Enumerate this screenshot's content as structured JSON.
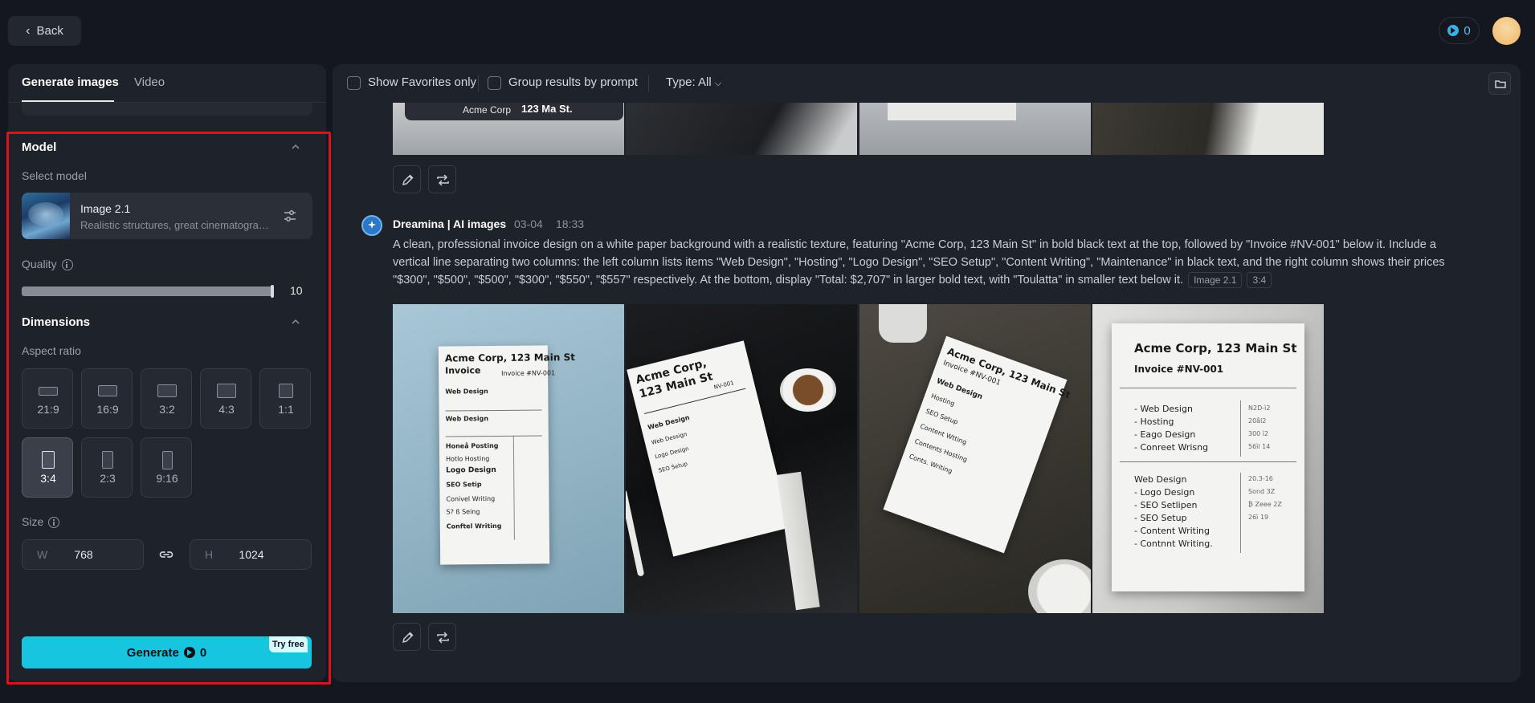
{
  "topbar": {
    "back_label": "Back",
    "credits": "0"
  },
  "left_panel": {
    "tabs": [
      {
        "label": "Generate images",
        "active": true
      },
      {
        "label": "Video",
        "active": false
      }
    ],
    "model_section": {
      "title": "Model",
      "select_label": "Select model",
      "model_name": "Image 2.1",
      "model_desc": "Realistic structures, great cinematography"
    },
    "quality": {
      "label": "Quality",
      "value_text": "10",
      "fraction": 1.0
    },
    "dimensions": {
      "title": "Dimensions",
      "aspect_label": "Aspect ratio",
      "ratios": [
        "21:9",
        "16:9",
        "3:2",
        "4:3",
        "1:1",
        "3:4",
        "2:3",
        "9:16"
      ],
      "selected": "3:4"
    },
    "size": {
      "label": "Size",
      "w_letter": "W",
      "w_value": "768",
      "h_letter": "H",
      "h_value": "1024"
    },
    "generate": {
      "label": "Generate",
      "cost": "0",
      "badge": "Try free"
    }
  },
  "main_panel": {
    "filters": {
      "favorites": "Show Favorites only",
      "group": "Group results by prompt",
      "type": "Type: All"
    },
    "top_row_image_text": [
      "Acme Corp",
      "123 Ma St."
    ],
    "message": {
      "author": "Dreamina | AI images",
      "date": "03-04",
      "time": "18:33",
      "prompt": "A clean, professional invoice design on a white paper background with a realistic texture, featuring \"Acme Corp, 123 Main St\" in bold black text at the top, followed by \"Invoice #NV-001\" below it. Include a vertical line separating two columns: the left column lists items \"Web Design\", \"Hosting\", \"Logo Design\", \"SEO Setup\", \"Content Writing\", \"Maintenance\" in black text, and the right column shows their prices \"$300\", \"$500\", \"$500\", \"$300\", \"$550\", \"$557\" respectively. At the bottom, display \"Total: $2,707\" in larger bold text, with \"Toulatta\" in smaller text below it.",
      "tag_model": "Image 2.1",
      "tag_ratio": "3:4"
    },
    "images": [
      {
        "title": [
          "Acme Corp, 123 Main St",
          "Invoice"
        ],
        "number": "Invoice #NV-001",
        "lines": [
          "Web Design",
          "Web Design",
          "Honeå Posting",
          "Hotlo Hosting",
          "Logo Design",
          "SEO Setip",
          "Conivel Writing",
          "S? ß Seing",
          "Conftel Writing"
        ]
      },
      {
        "title": [
          "Acme Corp,",
          "123 Main St"
        ],
        "number": "NV-001",
        "lines": [
          "Web Design",
          "Web Dessign",
          "Logo Design",
          "SEO Setup"
        ]
      },
      {
        "title": [
          "Acme Corp, 123 Main St",
          "Invoice #NV-001"
        ],
        "number": "",
        "lines": [
          "Web Design",
          "Hosting",
          "SEO Setup",
          "Content Wtting",
          "Contents Hosting",
          "Conts. Writing"
        ]
      },
      {
        "title": [
          "Acme Corp, 123 Main St",
          "Invoice #NV-001"
        ],
        "number": "",
        "lines": [
          "- Web Design",
          "- Hosting",
          "- Eago Design",
          "- Conreet Wrisng",
          "Web Design",
          "- Logo Design",
          "- SEO Setlipen",
          "- SEO Setup",
          "- Content Writing",
          "- Contnnt Writing."
        ],
        "prices": [
          "N2D-ì2",
          "20ål2",
          "300 ì2",
          "56ìl 14",
          "20.3-16",
          "Sond 3Z",
          "₿ Zeee 2Z",
          "26ì 19"
        ]
      }
    ]
  }
}
